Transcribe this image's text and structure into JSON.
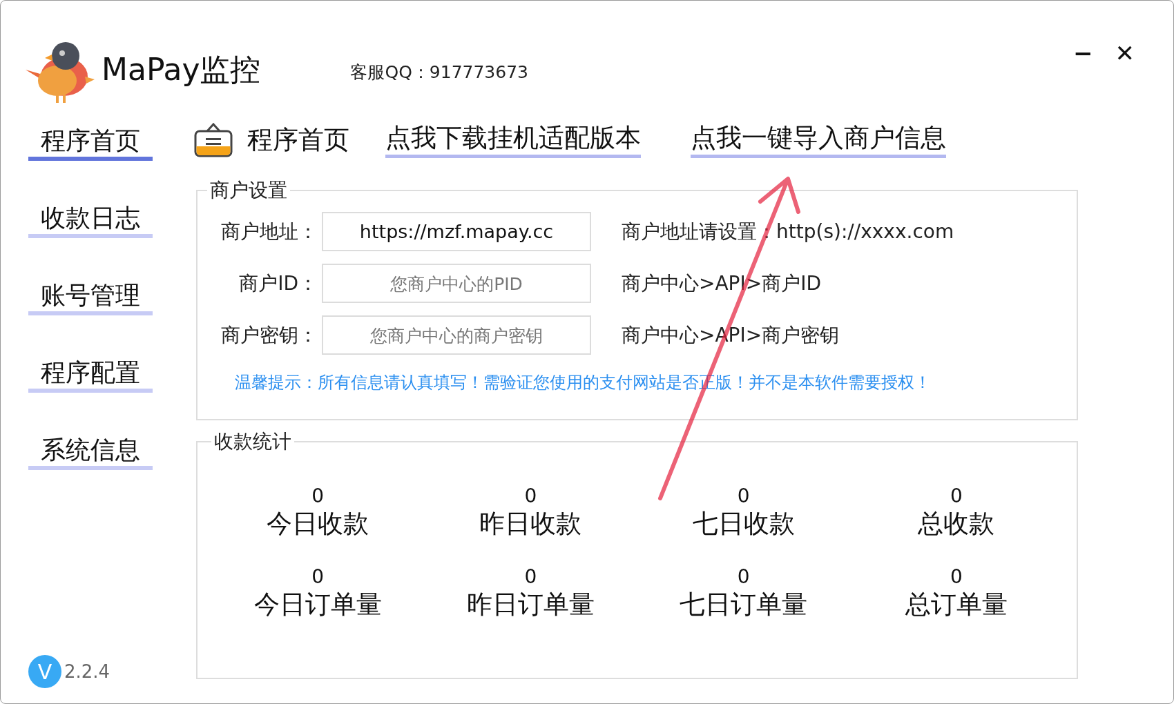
{
  "app": {
    "title": "MaPay监控",
    "support": "客服QQ：917773673",
    "version_badge": "V",
    "version": "2.2.4"
  },
  "window_controls": [
    "−",
    "✕"
  ],
  "sidebar": {
    "items": [
      {
        "label": "程序首页",
        "selected": true
      },
      {
        "label": "收款日志",
        "selected": false
      },
      {
        "label": "账号管理",
        "selected": false
      },
      {
        "label": "程序配置",
        "selected": false
      },
      {
        "label": "系统信息",
        "selected": false
      }
    ]
  },
  "header": {
    "page_title": "程序首页",
    "links": [
      "点我下载挂机适配版本",
      "点我一键导入商户信息"
    ]
  },
  "merchant_settings": {
    "title": "商户设置",
    "fields": [
      {
        "label": "商户地址：",
        "value": "https://mzf.mapay.cc",
        "hint": "商户地址请设置：http(s)://xxxx.com"
      },
      {
        "label": "商户ID：",
        "placeholder": "您商户中心的PID",
        "hint": "商户中心>API>商户ID"
      },
      {
        "label": "商户密钥：",
        "placeholder": "您商户中心的商户密钥",
        "hint": "商户中心>API>商户密钥"
      }
    ],
    "notice": "温馨提示：所有信息请认真填写！需验证您使用的支付网站是否正版！并不是本软件需要授权！"
  },
  "stats": {
    "title": "收款统计",
    "items": [
      {
        "value": "0",
        "label": "今日收款"
      },
      {
        "value": "0",
        "label": "昨日收款"
      },
      {
        "value": "0",
        "label": "七日收款"
      },
      {
        "value": "0",
        "label": "总收款"
      },
      {
        "value": "0",
        "label": "今日订单量"
      },
      {
        "value": "0",
        "label": "昨日订单量"
      },
      {
        "value": "0",
        "label": "七日订单量"
      },
      {
        "value": "0",
        "label": "总订单量"
      }
    ]
  }
}
